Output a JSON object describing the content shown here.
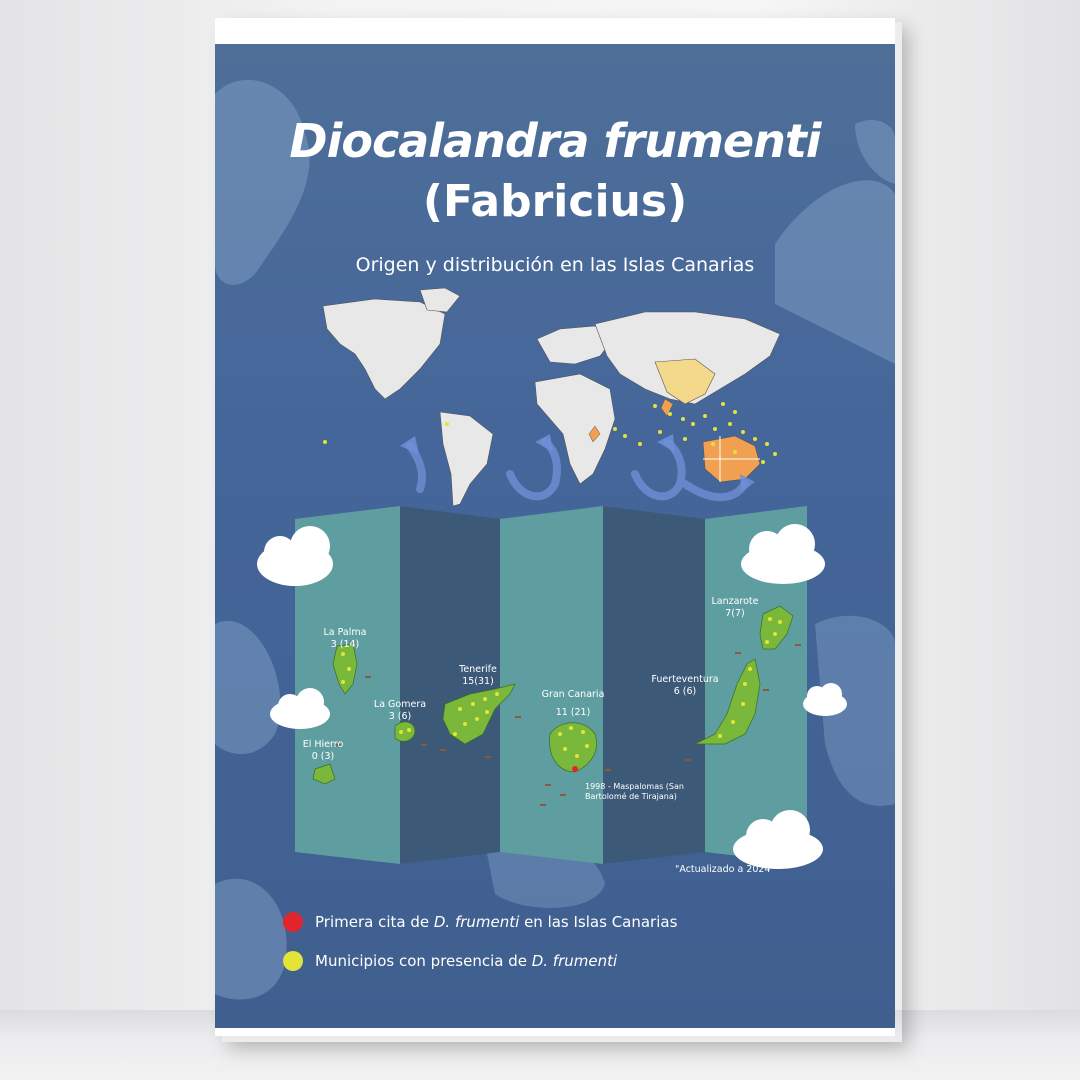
{
  "poster": {
    "title_line1": "Diocalandra frumenti",
    "title_line2": "(Fabricius)",
    "subtitle": "Origen y distribución en las Islas Canarias",
    "updated": "\"Actualizado a 2024\""
  },
  "islands": [
    {
      "name": "La Palma",
      "count": "3 (14)"
    },
    {
      "name": "La Gomera",
      "count": "3 (6)"
    },
    {
      "name": "El Hierro",
      "count": "0 (3)"
    },
    {
      "name": "Tenerife",
      "count": "15(31)"
    },
    {
      "name": "Gran Canaria",
      "count": "11 (21)"
    },
    {
      "name": "Fuerteventura",
      "count": "6 (6)"
    },
    {
      "name": "Lanzarote",
      "count": "7(7)"
    }
  ],
  "first_record_note": "1998 - Maspalomas (San Bartolomé de Tirajana)",
  "legend": [
    {
      "color": "#e0262c",
      "prefix": "Primera cita de ",
      "species": "D. frumenti",
      "suffix": " en las Islas Canarias"
    },
    {
      "color": "#e3e33a",
      "prefix": "Municipios con presencia de ",
      "species": "D. frumenti",
      "suffix": ""
    }
  ],
  "colors": {
    "poster_bg": "#45669a",
    "panel_light": "#5f9ea0",
    "panel_dark": "#3c5a78",
    "island_green": "#7ab83b",
    "origin_orange": "#f0a050",
    "native_yellow": "#f5d98a",
    "cloud": "#ffffff"
  }
}
